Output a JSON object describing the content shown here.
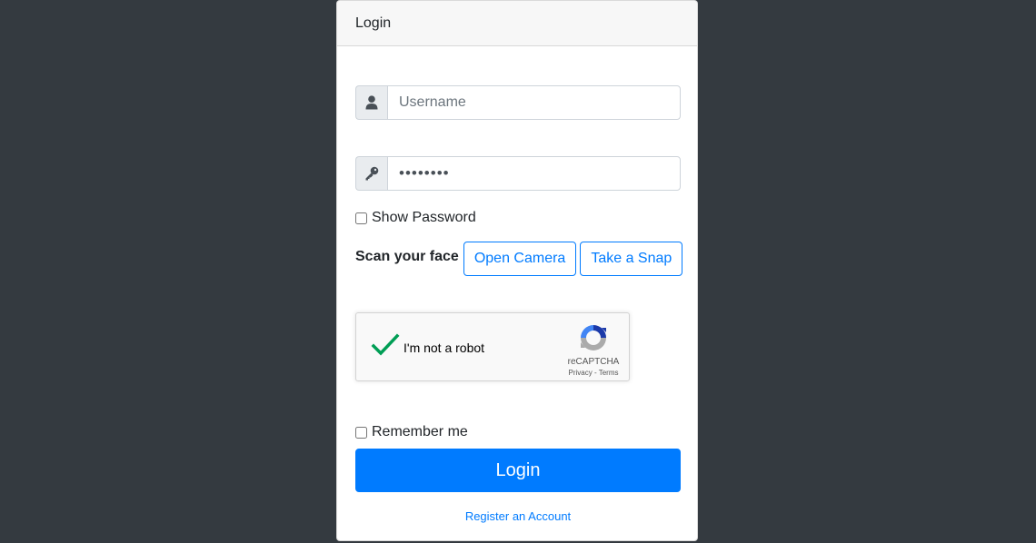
{
  "card": {
    "header": "Login"
  },
  "username": {
    "placeholder": "Username",
    "value": ""
  },
  "password": {
    "value": "password"
  },
  "show_password": {
    "label": "Show Password",
    "checked": false
  },
  "face_scan": {
    "label": "Scan your face",
    "open_camera": "Open Camera",
    "take_snap": "Take a Snap"
  },
  "recaptcha": {
    "label": "I'm not a robot",
    "brand": "reCAPTCHA",
    "privacy": "Privacy",
    "separator": " - ",
    "terms": "Terms",
    "verified": true,
    "check_color": "#009e55"
  },
  "remember_me": {
    "label": "Remember me",
    "checked": false
  },
  "login_button": "Login",
  "register_link": "Register an Account",
  "colors": {
    "background": "#343a40",
    "primary": "#007bff"
  },
  "icons": {
    "username": "user-icon",
    "password": "key-icon",
    "recaptcha_check": "checkmark-icon",
    "recaptcha_logo": "recaptcha-logo-icon"
  }
}
